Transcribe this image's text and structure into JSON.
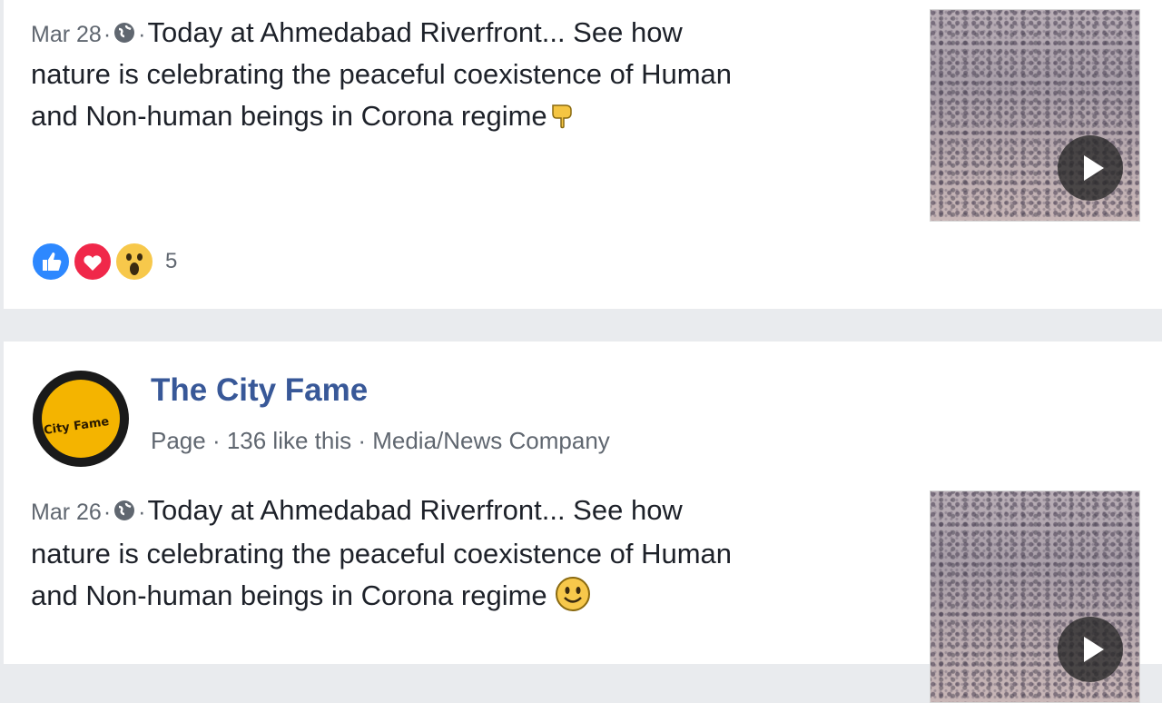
{
  "posts": [
    {
      "date": "Mar 28",
      "line1": "Today at Ahmedabad Riverfront... See how",
      "line2": "nature is celebrating the peaceful coexistence of Human",
      "line3": "and Non-human beings in Corona regime",
      "trailing_emoji": "pointing-down-hand",
      "reaction_count": "5",
      "reactions": [
        "like",
        "love",
        "wow"
      ]
    },
    {
      "page_name": "The City Fame",
      "page_meta": "Page · 136 like this · Media/News Company",
      "avatar_text": "City Fame",
      "date": "Mar 26",
      "line1": "Today at Ahmedabad Riverfront... See how",
      "line2": "nature is celebrating the peaceful coexistence of Human",
      "line3": "and Non-human beings in Corona regime",
      "trailing_emoji": "smiling-face"
    }
  ],
  "separator": "·",
  "colors": {
    "page_name": "#385898",
    "text": "#1d2129",
    "meta": "#606770",
    "feed_bg": "#e9ebee"
  }
}
